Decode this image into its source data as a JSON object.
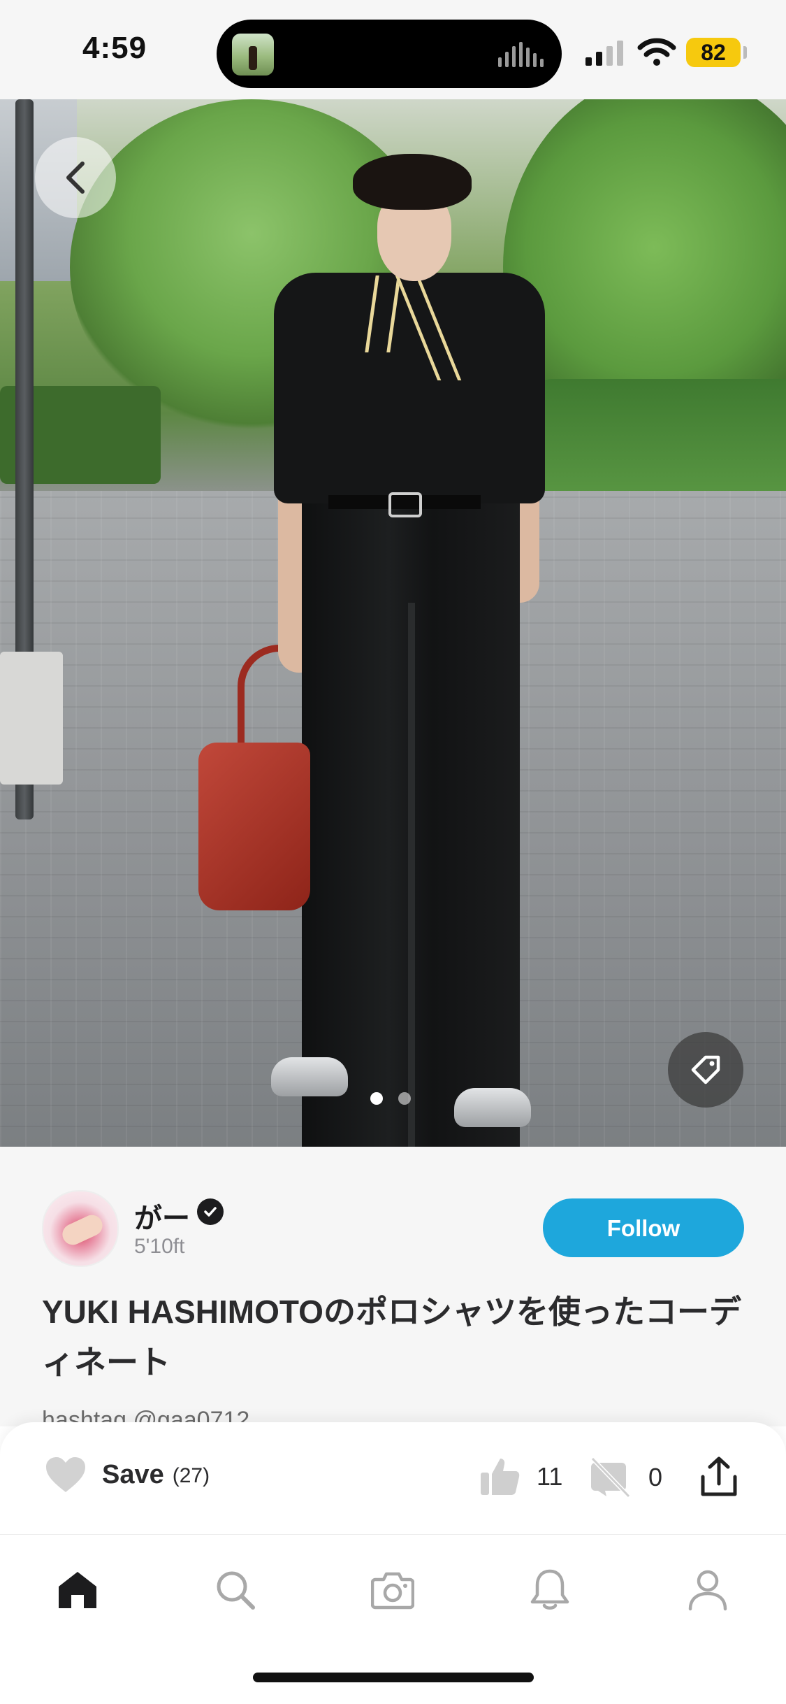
{
  "status_bar": {
    "time": "4:59",
    "battery": "82"
  },
  "post": {
    "username": "がー",
    "height": "5'10ft",
    "follow_label": "Follow",
    "title": "YUKI HASHIMOTOのポロシャツを使ったコーディネート",
    "peek": "hashtag @gaa0712"
  },
  "actions": {
    "save_label": "Save",
    "save_count": "(27)",
    "like_count": "11",
    "dislike_count": "0"
  },
  "icons": {
    "back": "chevron-left-icon",
    "tag": "tag-icon",
    "save": "heart-icon",
    "like": "thumbs-up-icon",
    "hide": "hide-icon",
    "share": "share-icon",
    "tabs": [
      "home-icon",
      "search-icon",
      "camera-icon",
      "bell-icon",
      "profile-icon"
    ]
  },
  "colors": {
    "accent": "#1ea7dc",
    "battery": "#f6c90e"
  },
  "carousel": {
    "page": 1,
    "total": 2
  }
}
